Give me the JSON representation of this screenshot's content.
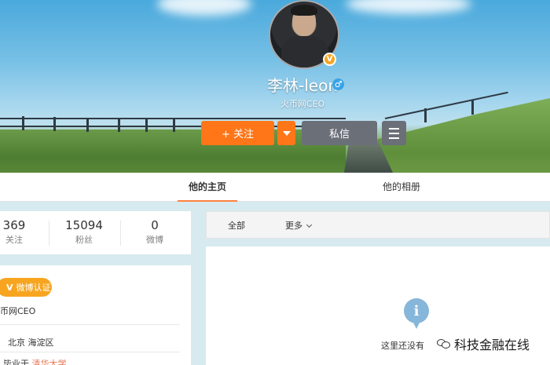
{
  "profile": {
    "name": "李林-leon",
    "gender_symbol": "♂",
    "intro": "火币网CEO",
    "verified_badge": "V"
  },
  "actions": {
    "follow_label": "+ 关注",
    "message_label": "私信"
  },
  "tabs": [
    {
      "label": "他的主页"
    },
    {
      "label": "他的相册"
    }
  ],
  "stats": [
    {
      "value": "369",
      "label": "关注"
    },
    {
      "value": "15094",
      "label": "粉丝"
    },
    {
      "value": "0",
      "label": "微博"
    }
  ],
  "info": {
    "verified_label": "微博认证",
    "verified_v": "V",
    "title": "币网CEO",
    "location": "北京 海淀区",
    "education_prefix": "毕业于",
    "education_school": "清华大学"
  },
  "feed_filter": {
    "all_label": "全部",
    "more_label": "更多"
  },
  "empty_state": {
    "icon_glyph": "i",
    "text": "这里还没有"
  },
  "watermark": {
    "text": "科技金融在线"
  },
  "colors": {
    "accent_orange": "#ff7618",
    "verified_gold": "#f7a520",
    "button_gray": "#6b6f78",
    "male_blue": "#3aa2e6"
  }
}
